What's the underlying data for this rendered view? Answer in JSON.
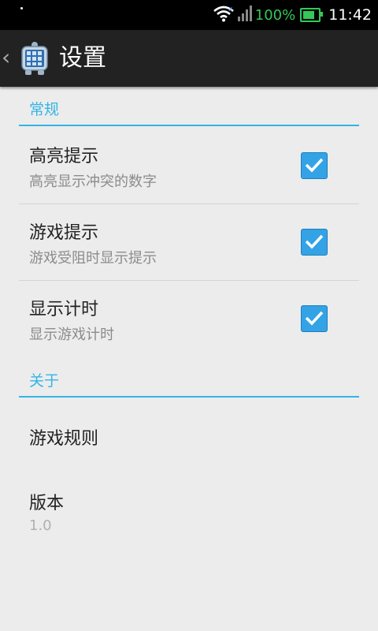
{
  "status_bar": {
    "battery_percent": "100%",
    "time": "11:42",
    "colors": {
      "battery": "#34c759"
    },
    "icons": [
      "wifi-icon",
      "signal-icon",
      "battery-icon"
    ]
  },
  "action_bar": {
    "title": "设置",
    "icons": [
      "back-chevron-icon",
      "app-icon"
    ]
  },
  "sections": {
    "general": {
      "header": "常规"
    },
    "about": {
      "header": "关于"
    }
  },
  "preferences": {
    "highlight": {
      "title": "高亮提示",
      "summary": "高亮显示冲突的数字",
      "checked": true
    },
    "game_hint": {
      "title": "游戏提示",
      "summary": "游戏受阻时显示提示",
      "checked": true
    },
    "timer": {
      "title": "显示计时",
      "summary": "显示游戏计时",
      "checked": true
    },
    "rules": {
      "title": "游戏规则"
    },
    "version": {
      "title": "版本",
      "summary": "1.0"
    }
  },
  "colors": {
    "accent": "#33b5e5",
    "checkbox": "#33a3e6"
  }
}
